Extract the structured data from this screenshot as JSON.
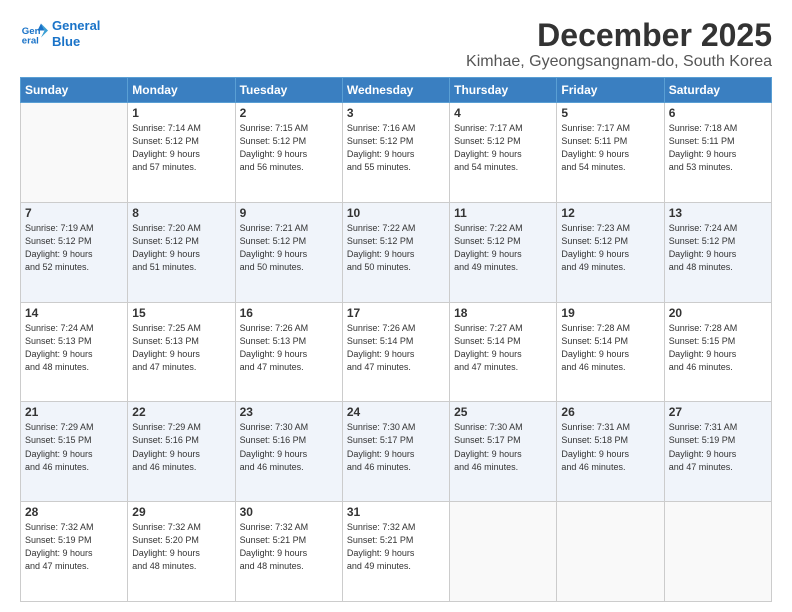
{
  "header": {
    "logo_line1": "General",
    "logo_line2": "Blue",
    "title": "December 2025",
    "subtitle": "Kimhae, Gyeongsangnam-do, South Korea"
  },
  "calendar": {
    "days_of_week": [
      "Sunday",
      "Monday",
      "Tuesday",
      "Wednesday",
      "Thursday",
      "Friday",
      "Saturday"
    ],
    "weeks": [
      [
        {
          "day": "",
          "info": ""
        },
        {
          "day": "1",
          "info": "Sunrise: 7:14 AM\nSunset: 5:12 PM\nDaylight: 9 hours\nand 57 minutes."
        },
        {
          "day": "2",
          "info": "Sunrise: 7:15 AM\nSunset: 5:12 PM\nDaylight: 9 hours\nand 56 minutes."
        },
        {
          "day": "3",
          "info": "Sunrise: 7:16 AM\nSunset: 5:12 PM\nDaylight: 9 hours\nand 55 minutes."
        },
        {
          "day": "4",
          "info": "Sunrise: 7:17 AM\nSunset: 5:12 PM\nDaylight: 9 hours\nand 54 minutes."
        },
        {
          "day": "5",
          "info": "Sunrise: 7:17 AM\nSunset: 5:11 PM\nDaylight: 9 hours\nand 54 minutes."
        },
        {
          "day": "6",
          "info": "Sunrise: 7:18 AM\nSunset: 5:11 PM\nDaylight: 9 hours\nand 53 minutes."
        }
      ],
      [
        {
          "day": "7",
          "info": "Sunrise: 7:19 AM\nSunset: 5:12 PM\nDaylight: 9 hours\nand 52 minutes."
        },
        {
          "day": "8",
          "info": "Sunrise: 7:20 AM\nSunset: 5:12 PM\nDaylight: 9 hours\nand 51 minutes."
        },
        {
          "day": "9",
          "info": "Sunrise: 7:21 AM\nSunset: 5:12 PM\nDaylight: 9 hours\nand 50 minutes."
        },
        {
          "day": "10",
          "info": "Sunrise: 7:22 AM\nSunset: 5:12 PM\nDaylight: 9 hours\nand 50 minutes."
        },
        {
          "day": "11",
          "info": "Sunrise: 7:22 AM\nSunset: 5:12 PM\nDaylight: 9 hours\nand 49 minutes."
        },
        {
          "day": "12",
          "info": "Sunrise: 7:23 AM\nSunset: 5:12 PM\nDaylight: 9 hours\nand 49 minutes."
        },
        {
          "day": "13",
          "info": "Sunrise: 7:24 AM\nSunset: 5:12 PM\nDaylight: 9 hours\nand 48 minutes."
        }
      ],
      [
        {
          "day": "14",
          "info": "Sunrise: 7:24 AM\nSunset: 5:13 PM\nDaylight: 9 hours\nand 48 minutes."
        },
        {
          "day": "15",
          "info": "Sunrise: 7:25 AM\nSunset: 5:13 PM\nDaylight: 9 hours\nand 47 minutes."
        },
        {
          "day": "16",
          "info": "Sunrise: 7:26 AM\nSunset: 5:13 PM\nDaylight: 9 hours\nand 47 minutes."
        },
        {
          "day": "17",
          "info": "Sunrise: 7:26 AM\nSunset: 5:14 PM\nDaylight: 9 hours\nand 47 minutes."
        },
        {
          "day": "18",
          "info": "Sunrise: 7:27 AM\nSunset: 5:14 PM\nDaylight: 9 hours\nand 47 minutes."
        },
        {
          "day": "19",
          "info": "Sunrise: 7:28 AM\nSunset: 5:14 PM\nDaylight: 9 hours\nand 46 minutes."
        },
        {
          "day": "20",
          "info": "Sunrise: 7:28 AM\nSunset: 5:15 PM\nDaylight: 9 hours\nand 46 minutes."
        }
      ],
      [
        {
          "day": "21",
          "info": "Sunrise: 7:29 AM\nSunset: 5:15 PM\nDaylight: 9 hours\nand 46 minutes."
        },
        {
          "day": "22",
          "info": "Sunrise: 7:29 AM\nSunset: 5:16 PM\nDaylight: 9 hours\nand 46 minutes."
        },
        {
          "day": "23",
          "info": "Sunrise: 7:30 AM\nSunset: 5:16 PM\nDaylight: 9 hours\nand 46 minutes."
        },
        {
          "day": "24",
          "info": "Sunrise: 7:30 AM\nSunset: 5:17 PM\nDaylight: 9 hours\nand 46 minutes."
        },
        {
          "day": "25",
          "info": "Sunrise: 7:30 AM\nSunset: 5:17 PM\nDaylight: 9 hours\nand 46 minutes."
        },
        {
          "day": "26",
          "info": "Sunrise: 7:31 AM\nSunset: 5:18 PM\nDaylight: 9 hours\nand 46 minutes."
        },
        {
          "day": "27",
          "info": "Sunrise: 7:31 AM\nSunset: 5:19 PM\nDaylight: 9 hours\nand 47 minutes."
        }
      ],
      [
        {
          "day": "28",
          "info": "Sunrise: 7:32 AM\nSunset: 5:19 PM\nDaylight: 9 hours\nand 47 minutes."
        },
        {
          "day": "29",
          "info": "Sunrise: 7:32 AM\nSunset: 5:20 PM\nDaylight: 9 hours\nand 48 minutes."
        },
        {
          "day": "30",
          "info": "Sunrise: 7:32 AM\nSunset: 5:21 PM\nDaylight: 9 hours\nand 48 minutes."
        },
        {
          "day": "31",
          "info": "Sunrise: 7:32 AM\nSunset: 5:21 PM\nDaylight: 9 hours\nand 49 minutes."
        },
        {
          "day": "",
          "info": ""
        },
        {
          "day": "",
          "info": ""
        },
        {
          "day": "",
          "info": ""
        }
      ]
    ]
  }
}
